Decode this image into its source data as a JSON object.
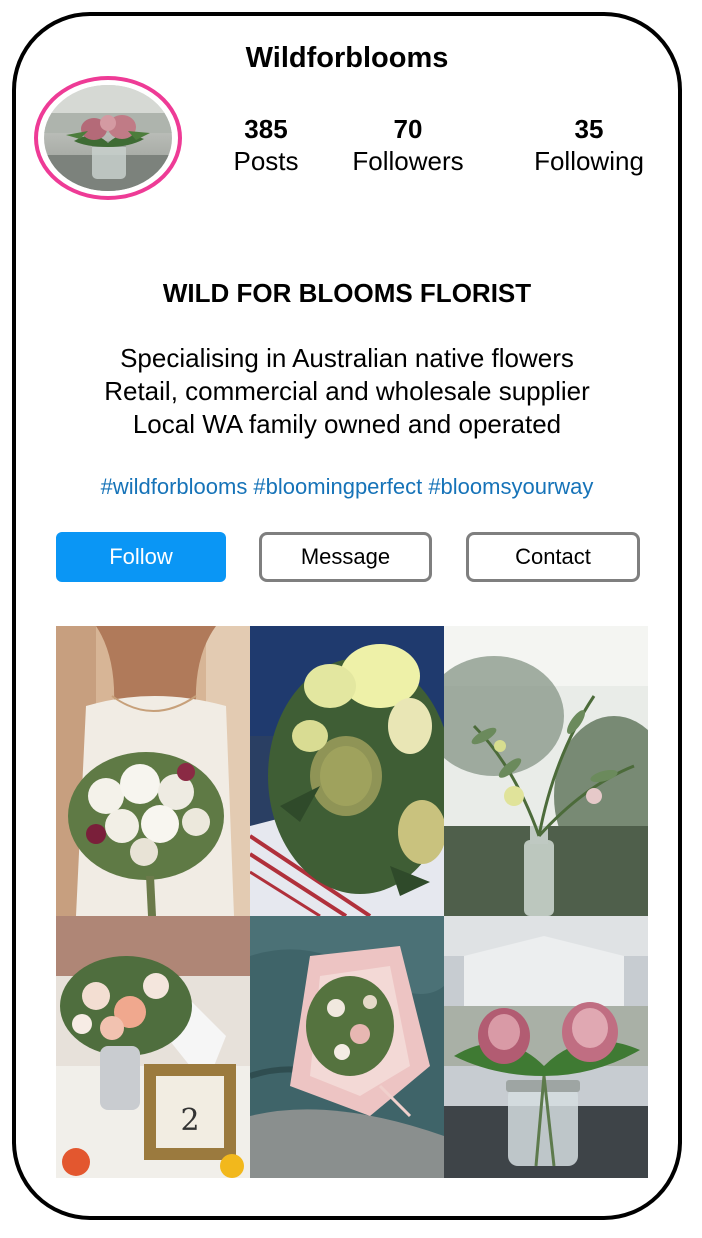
{
  "profile": {
    "username": "Wildforblooms",
    "avatar_icon": "protea-jar-avatar",
    "ring_color": "#ee3b96"
  },
  "stats": [
    {
      "value": "385",
      "label": "Posts"
    },
    {
      "value": "70",
      "label": "Followers"
    },
    {
      "value": "35",
      "label": "Following"
    }
  ],
  "bio": {
    "title": "WILD FOR BLOOMS FLORIST",
    "lines": [
      "Specialising in Australian native flowers",
      "Retail, commercial and wholesale supplier",
      "Local WA family owned and operated"
    ],
    "hashtags": "#wildforblooms #bloomingperfect #bloomsyourway",
    "hashtag_color": "#1673b8"
  },
  "actions": {
    "follow_label": "Follow",
    "message_label": "Message",
    "contact_label": "Contact",
    "follow_color": "#0a96f5"
  },
  "posts": [
    {
      "icon": "bridal-bouquet-photo"
    },
    {
      "icon": "banksia-arrangement-photo"
    },
    {
      "icon": "eucalyptus-vase-photo"
    },
    {
      "icon": "table-centerpiece-photo"
    },
    {
      "icon": "wrapped-bouquet-photo"
    },
    {
      "icon": "protea-jar-photo"
    }
  ]
}
